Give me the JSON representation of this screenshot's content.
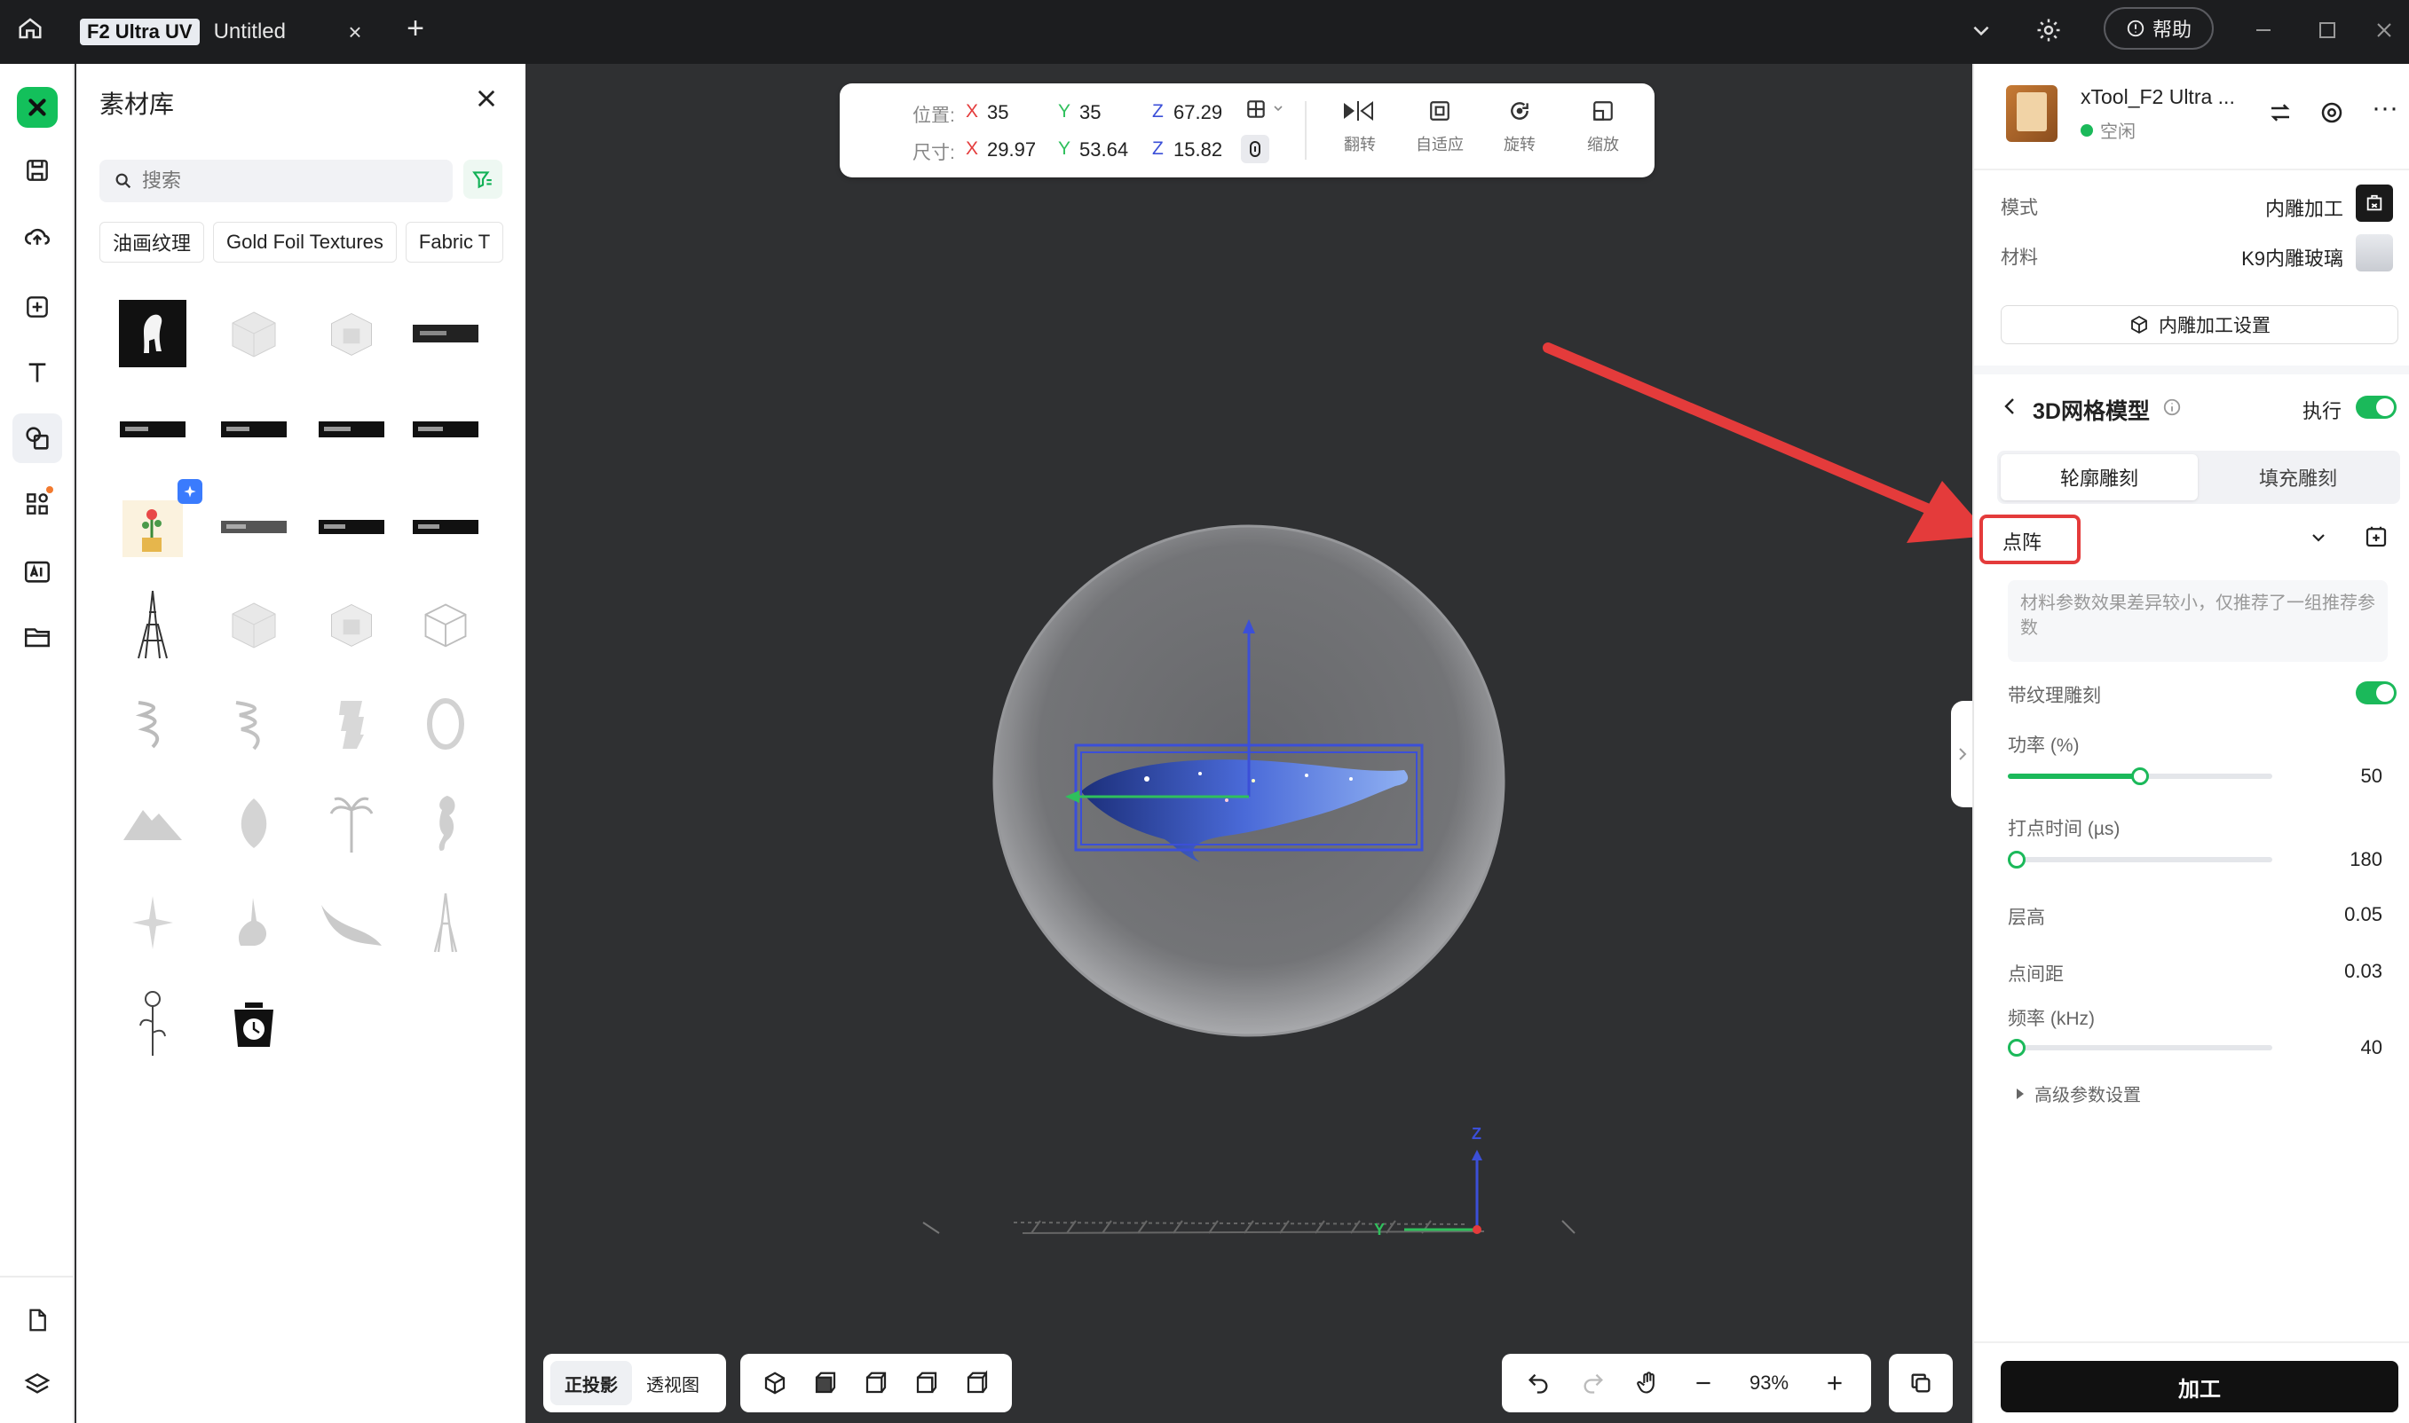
{
  "titlebar": {
    "tab_badge": "F2 Ultra UV",
    "tab_title": "Untitled",
    "tab_close": "×",
    "tab_add": "+",
    "help_label": "帮助"
  },
  "material_panel": {
    "title": "素材库",
    "search_placeholder": "搜索",
    "chips": [
      "油画纹理",
      "Gold Foil Textures",
      "Fabric T"
    ]
  },
  "transform": {
    "position_label": "位置:",
    "size_label": "尺寸:",
    "pos_x": "35",
    "pos_y": "35",
    "pos_z": "67.29",
    "size_x": "29.97",
    "size_y": "53.64",
    "size_z": "15.82",
    "axis_x": "X",
    "axis_y": "Y",
    "axis_z": "Z",
    "flip_label": "翻转",
    "fit_label": "自适应",
    "rotate_label": "旋转",
    "scale_label": "缩放"
  },
  "view": {
    "ortho_label": "正投影",
    "persp_label": "透视图",
    "zoom": "93%",
    "axis_label_z": "Z",
    "axis_label_y": "Y"
  },
  "right_panel": {
    "device_name": "xTool_F2 Ultra ...",
    "device_status": "空闲",
    "mode_label": "模式",
    "mode_value": "内雕加工",
    "material_label": "材料",
    "material_value": "K9内雕玻璃",
    "settings_button": "内雕加工设置",
    "section_title": "3D网格模型",
    "execute_label": "执行",
    "tab_outline": "轮廓雕刻",
    "tab_fill": "填充雕刻",
    "preset_value": "点阵",
    "hint_text": "材料参数效果差异较小，仅推荐了一组推荐参数",
    "texture_label": "带纹理雕刻",
    "power_label": "功率 (%)",
    "power_value": "50",
    "power_fraction": 0.5,
    "dot_time_label": "打点时间 (µs)",
    "dot_time_value": "180",
    "dot_time_fraction": 0.02,
    "layer_height_label": "层高",
    "layer_height_value": "0.05",
    "dot_spacing_label": "点间距",
    "dot_spacing_value": "0.03",
    "frequency_label": "频率 (kHz)",
    "frequency_value": "40",
    "frequency_fraction": 0.0,
    "advanced_label": "高级参数设置",
    "process_button": "加工"
  },
  "colors": {
    "accent_green": "#1bb95a",
    "highlight_red": "#e43b3b",
    "canvas_bg": "#2f3032",
    "selection_blue": "#3b4fd8"
  }
}
